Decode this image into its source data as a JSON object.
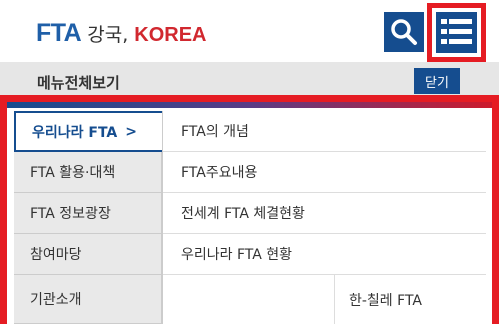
{
  "header": {
    "logo_fta": "FTA",
    "logo_kr": "강국,",
    "logo_en": "KOREA",
    "search_icon": "search-icon",
    "menu_icon": "hamburger-menu-icon"
  },
  "title_bar": {
    "title": "메뉴전체보기",
    "close_label": "닫기"
  },
  "colors": {
    "brand_blue": "#154d8f",
    "accent_red": "#e51c23"
  },
  "left_menu": {
    "items": [
      {
        "label": "우리나라 FTA",
        "chevron": ">"
      },
      {
        "label": "FTA 활용·대책"
      },
      {
        "label": "FTA 정보광장"
      },
      {
        "label": "참여마당"
      },
      {
        "label": "기관소개"
      }
    ]
  },
  "sub_menu": {
    "items": [
      {
        "label": "FTA의 개념"
      },
      {
        "label": "FTA주요내용"
      },
      {
        "label": "전세계 FTA 체결현황"
      },
      {
        "label": "우리나라 FTA 현황"
      },
      {
        "label": ""
      },
      {
        "label": "한-칠레 FTA"
      }
    ]
  }
}
